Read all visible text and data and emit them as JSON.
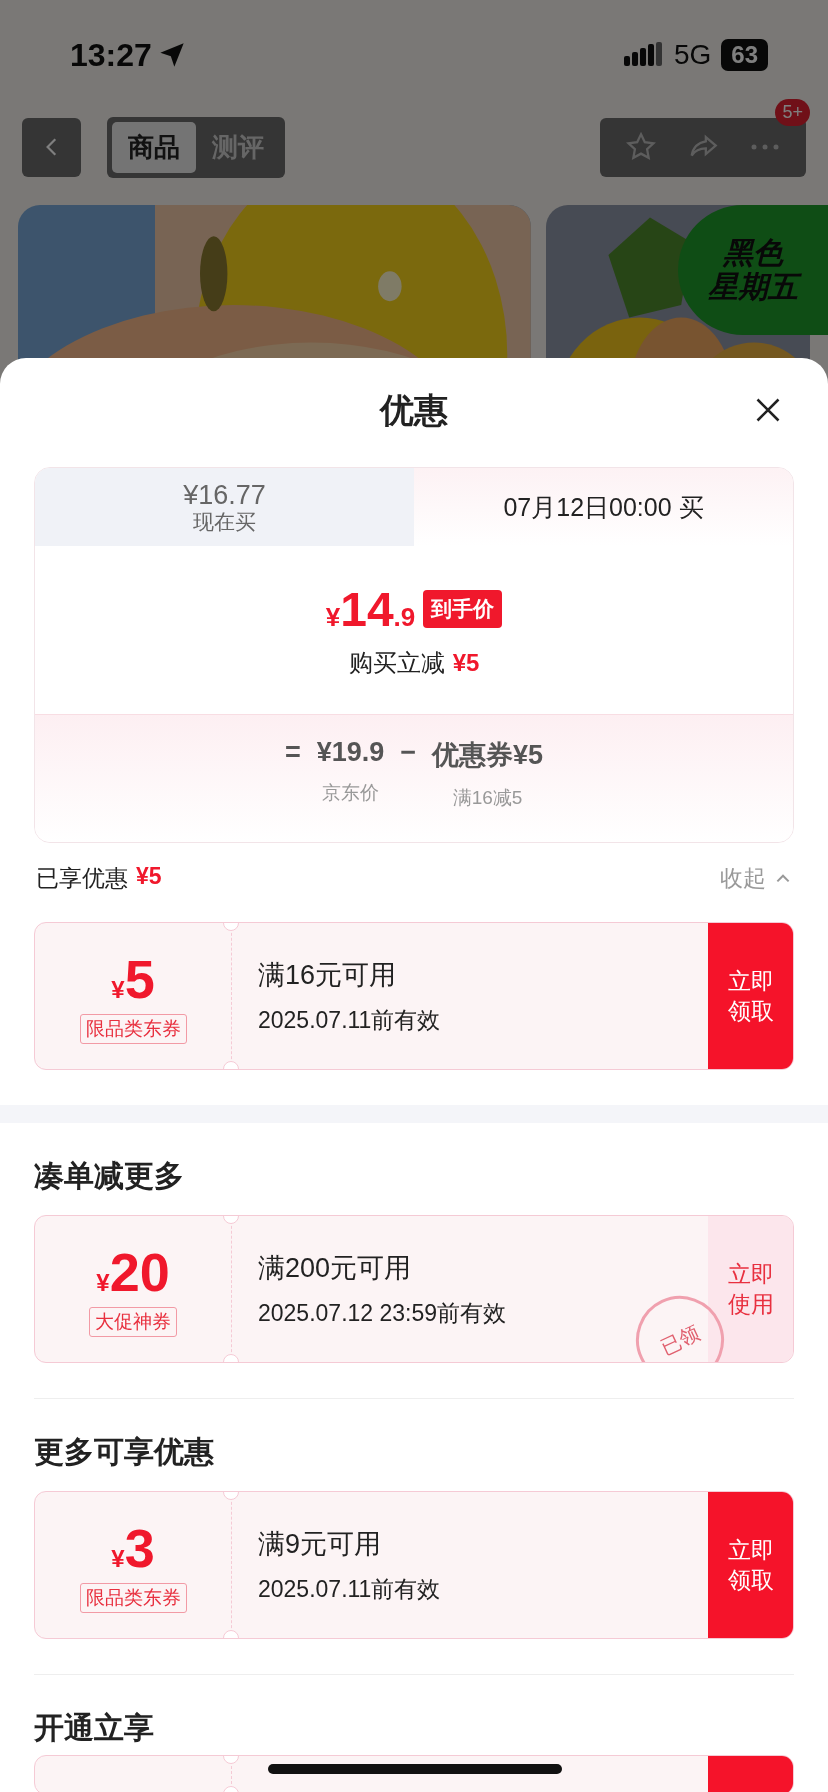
{
  "status_bar": {
    "time": "13:27",
    "network": "5G",
    "battery": "63"
  },
  "nav": {
    "segments": [
      {
        "label": "商品",
        "selected": true
      },
      {
        "label": "测评",
        "selected": false
      }
    ],
    "badge": "5+"
  },
  "promo_tag": [
    "黑色",
    "星期五"
  ],
  "sheet": {
    "title": "优惠"
  },
  "price_tabs": [
    {
      "price": "¥16.77",
      "label": "现在买",
      "selected": false
    },
    {
      "label": "07月12日00:00 买",
      "selected": true
    }
  ],
  "final_price": {
    "currency": "¥",
    "integer": "14",
    "decimal": ".9",
    "tag": "到手价"
  },
  "instant_discount": {
    "label": "购买立减",
    "amount": "¥5"
  },
  "breakdown": {
    "equals": "=",
    "operator": "−",
    "terms": [
      {
        "value": "¥19.9",
        "note": "京东价"
      },
      {
        "value": "优惠券¥5",
        "note": "满16减5"
      }
    ]
  },
  "applied": {
    "label": "已享优惠",
    "amount": "¥5",
    "toggle": "收起",
    "expanded": true
  },
  "sections": [
    {
      "coupons": [
        {
          "currency": "¥",
          "amount": "5",
          "tag": "限品类东券",
          "condition": "满16元可用",
          "validity": "2025.07.11前有效",
          "action": "立即领取",
          "claimed": false
        }
      ]
    },
    {
      "title": "凑单减更多",
      "coupons": [
        {
          "currency": "¥",
          "amount": "20",
          "tag": "大促神券",
          "condition": "满200元可用",
          "validity": "2025.07.12 23:59前有效",
          "action": "立即使用",
          "claimed": true,
          "stamp": "已领"
        }
      ]
    },
    {
      "title": "更多可享优惠",
      "coupons": [
        {
          "currency": "¥",
          "amount": "3",
          "tag": "限品类东券",
          "condition": "满9元可用",
          "validity": "2025.07.11前有效",
          "action": "立即领取",
          "claimed": false
        }
      ]
    },
    {
      "title": "开通立享",
      "coupons": [
        {
          "kind": "cut-off",
          "claimed": false
        }
      ]
    }
  ]
}
